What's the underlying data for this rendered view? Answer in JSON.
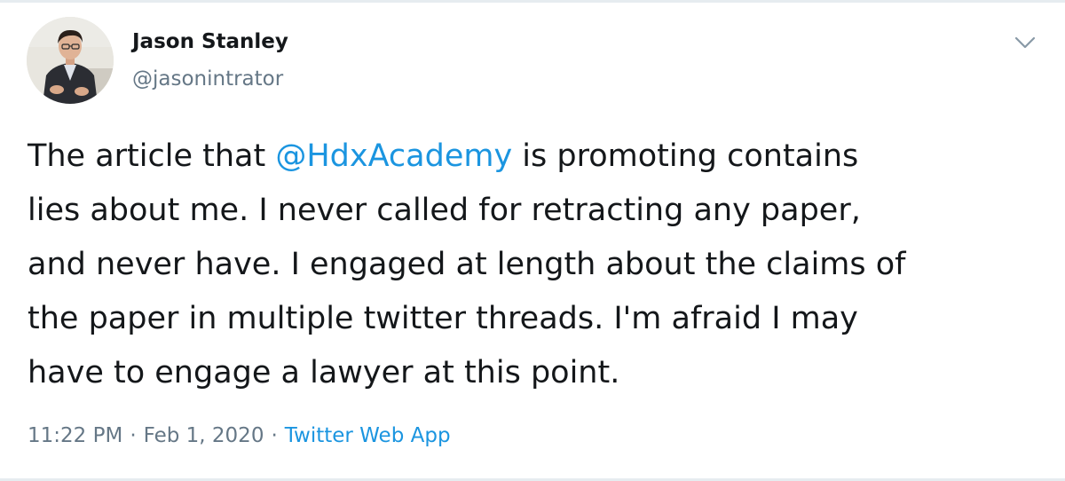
{
  "author": {
    "name": "Jason Stanley",
    "handle": "@jasonintrator"
  },
  "menu": {
    "icon": "chevron-down-icon"
  },
  "tweet": {
    "lines": [
      {
        "before": "The article that ",
        "mention": "@HdxAcademy",
        "after": " is promoting contains"
      },
      {
        "text": "lies about me. I never called for retracting any paper,"
      },
      {
        "text": "and never have. I engaged at length about the claims of"
      },
      {
        "text": "the paper in multiple twitter threads. I'm afraid I may"
      },
      {
        "text": "have to engage a lawyer at this point."
      }
    ]
  },
  "meta": {
    "time": "11:22 PM",
    "separator": "·",
    "date": "Feb 1, 2020",
    "source": "Twitter Web App"
  },
  "colors": {
    "text": "#14171a",
    "secondary": "#657786",
    "link": "#1b95e0",
    "border": "#e6ecf0"
  }
}
